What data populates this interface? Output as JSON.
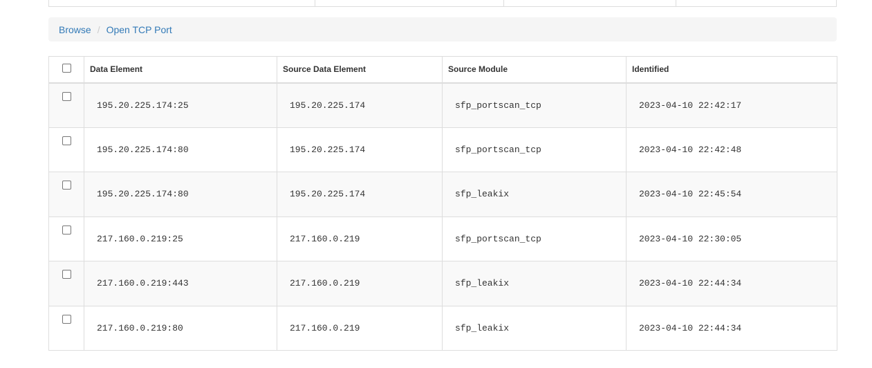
{
  "breadcrumb": {
    "items": [
      "Browse",
      "Open TCP Port"
    ],
    "separator": "/"
  },
  "table": {
    "headers": [
      "Data Element",
      "Source Data Element",
      "Source Module",
      "Identified"
    ],
    "rows": [
      {
        "data_element": "195.20.225.174:25",
        "source_data_element": "195.20.225.174",
        "source_module": "sfp_portscan_tcp",
        "identified": "2023-04-10 22:42:17"
      },
      {
        "data_element": "195.20.225.174:80",
        "source_data_element": "195.20.225.174",
        "source_module": "sfp_portscan_tcp",
        "identified": "2023-04-10 22:42:48"
      },
      {
        "data_element": "195.20.225.174:80",
        "source_data_element": "195.20.225.174",
        "source_module": "sfp_leakix",
        "identified": "2023-04-10 22:45:54"
      },
      {
        "data_element": "217.160.0.219:25",
        "source_data_element": "217.160.0.219",
        "source_module": "sfp_portscan_tcp",
        "identified": "2023-04-10 22:30:05"
      },
      {
        "data_element": "217.160.0.219:443",
        "source_data_element": "217.160.0.219",
        "source_module": "sfp_leakix",
        "identified": "2023-04-10 22:44:34"
      },
      {
        "data_element": "217.160.0.219:80",
        "source_data_element": "217.160.0.219",
        "source_module": "sfp_leakix",
        "identified": "2023-04-10 22:44:34"
      }
    ]
  }
}
